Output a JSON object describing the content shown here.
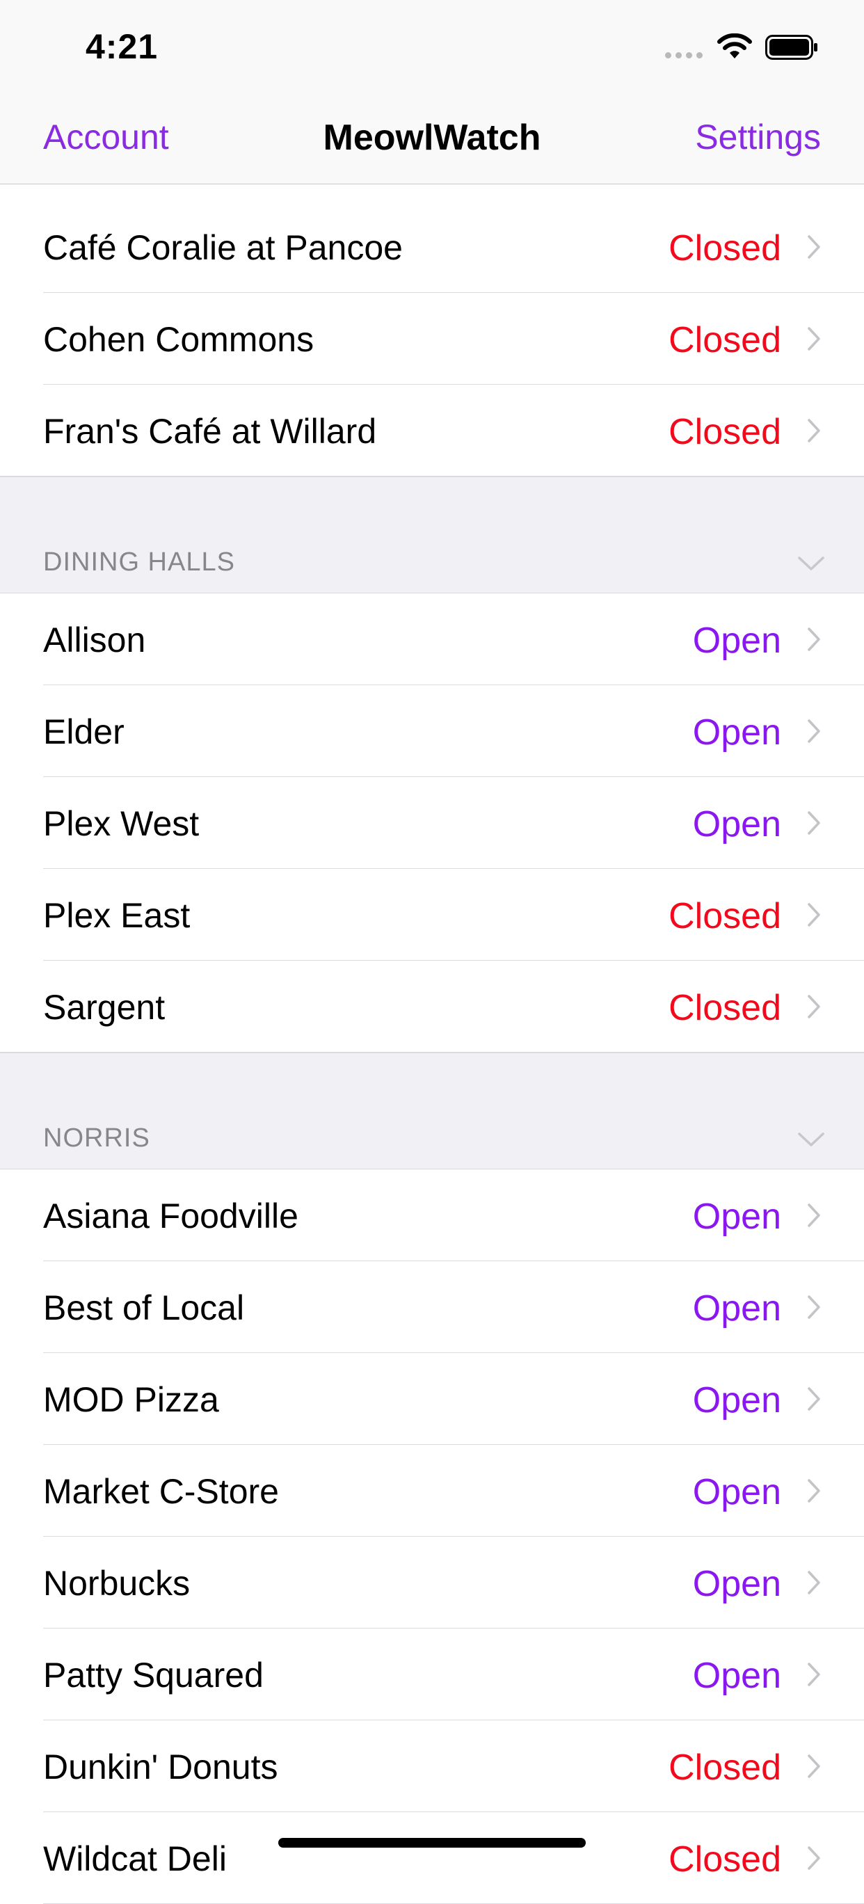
{
  "status_bar": {
    "time": "4:21"
  },
  "nav": {
    "left_label": "Account",
    "title": "MeowlWatch",
    "right_label": "Settings"
  },
  "colors": {
    "accent": "#8a2be2",
    "open": "#8a17f0",
    "closed": "#f2091b"
  },
  "sections": [
    {
      "header": "",
      "rows": [
        {
          "name": "Café Coralie at Pancoe",
          "status": "Closed"
        },
        {
          "name": "Cohen Commons",
          "status": "Closed"
        },
        {
          "name": "Fran's Café at Willard",
          "status": "Closed"
        }
      ]
    },
    {
      "header": "DINING HALLS",
      "rows": [
        {
          "name": "Allison",
          "status": "Open"
        },
        {
          "name": "Elder",
          "status": "Open"
        },
        {
          "name": "Plex West",
          "status": "Open"
        },
        {
          "name": "Plex East",
          "status": "Closed"
        },
        {
          "name": "Sargent",
          "status": "Closed"
        }
      ]
    },
    {
      "header": "NORRIS",
      "rows": [
        {
          "name": "Asiana Foodville",
          "status": "Open"
        },
        {
          "name": "Best of Local",
          "status": "Open"
        },
        {
          "name": "MOD Pizza",
          "status": "Open"
        },
        {
          "name": "Market C-Store",
          "status": "Open"
        },
        {
          "name": "Norbucks",
          "status": "Open"
        },
        {
          "name": "Patty Squared",
          "status": "Open"
        },
        {
          "name": "Dunkin' Donuts",
          "status": "Closed"
        },
        {
          "name": "Wildcat Deli",
          "status": "Closed"
        }
      ]
    }
  ]
}
